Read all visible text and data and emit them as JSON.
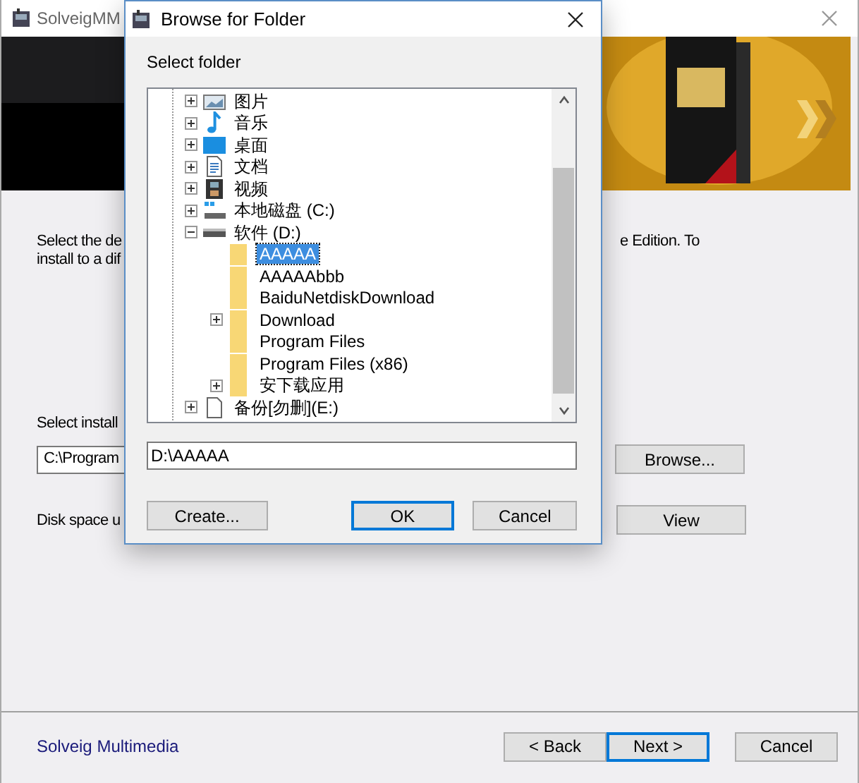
{
  "window": {
    "title": "SolveigMM"
  },
  "content": {
    "description_left": [
      "Select the de",
      "install to a dif"
    ],
    "description_right": "e Edition. To",
    "folder_label": "Select install",
    "folder_value": "C:\\Program",
    "browse_button": "Browse...",
    "disk_label": "Disk space u",
    "view_button": "View"
  },
  "footer": {
    "link": "Solveig Multimedia",
    "buttons": [
      {
        "label": "< Back",
        "default": false
      },
      {
        "label": "Next >",
        "default": true
      },
      {
        "label": "Cancel",
        "default": false
      }
    ]
  },
  "dialog": {
    "title": "Browse for Folder",
    "prompt": "Select folder",
    "tree": {
      "items": [
        {
          "label": "图片",
          "kind": "pictures",
          "expanded": false,
          "selected": false
        },
        {
          "label": "音乐",
          "kind": "music",
          "expanded": false,
          "selected": false
        },
        {
          "label": "桌面",
          "kind": "desktop",
          "expanded": false,
          "selected": false
        },
        {
          "label": "文档",
          "kind": "documents",
          "expanded": false,
          "selected": false
        },
        {
          "label": "视频",
          "kind": "videos",
          "expanded": false,
          "selected": false
        },
        {
          "label": "本地磁盘 (C:)",
          "kind": "system-drive",
          "expanded": false,
          "selected": false
        },
        {
          "label": "软件 (D:)",
          "kind": "drive",
          "expanded": true,
          "selected": false,
          "children": [
            {
              "label": "AAAAA",
              "kind": "folder",
              "selected": true
            },
            {
              "label": "AAAAAbbb",
              "kind": "folder",
              "selected": false
            },
            {
              "label": "BaiduNetdiskDownload",
              "kind": "folder",
              "selected": false
            },
            {
              "label": "Download",
              "kind": "folder",
              "expanded": false,
              "selected": false
            },
            {
              "label": "Program Files",
              "kind": "folder",
              "selected": false
            },
            {
              "label": "Program Files (x86)",
              "kind": "folder",
              "selected": false
            },
            {
              "label": "安下载应用",
              "kind": "folder",
              "expanded": false,
              "selected": false
            }
          ]
        },
        {
          "label": "备份[勿删](E:)",
          "kind": "page",
          "expanded": false,
          "selected": false
        }
      ]
    },
    "path": "D:\\AAAAA",
    "buttons": [
      {
        "label": "Create...",
        "default": false
      },
      {
        "label": "OK",
        "default": true
      },
      {
        "label": "Cancel",
        "default": false
      }
    ]
  }
}
